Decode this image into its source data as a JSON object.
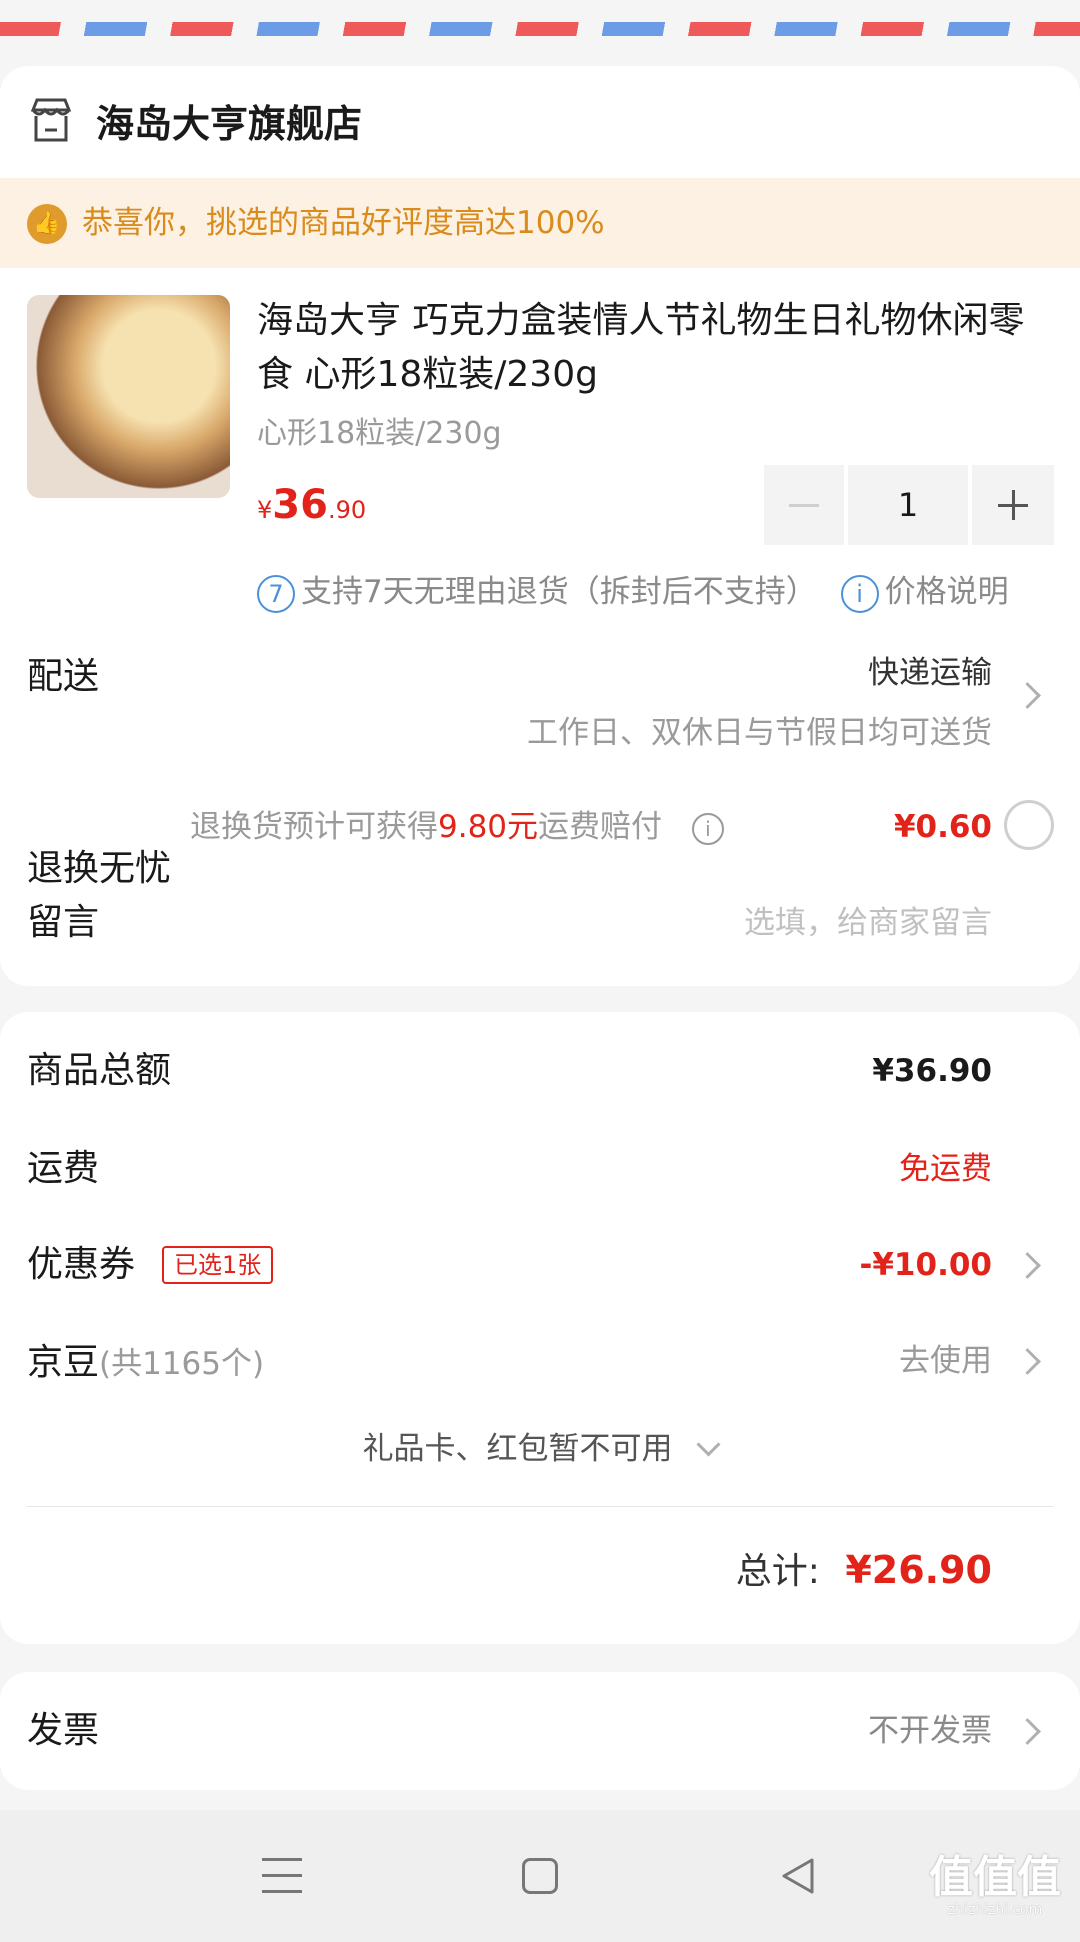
{
  "store": {
    "name": "海岛大亨旗舰店",
    "icon": "store-icon"
  },
  "banner": {
    "text": "恭喜你，挑选的商品好评度高达100%",
    "icon": "thumbs-up-icon",
    "color": "#d98b1c"
  },
  "product": {
    "name": "海岛大亨 巧克力盒装情人节礼物生日礼物休闲零食 心形18粒装/230g",
    "spec": "心形18粒装/230g",
    "price_symbol": "¥",
    "price_int": "36",
    "price_dec": ".90",
    "quantity": "1",
    "after_sale_icon_text": "7",
    "after_sale": "支持7天无理由退货（拆封后不支持）",
    "price_note_icon_text": "i",
    "price_note": "价格说明"
  },
  "delivery": {
    "label": "配送",
    "method": "快递运输",
    "note": "工作日、双休日与节假日均可送货"
  },
  "return_insurance": {
    "label": "退换无忧",
    "desc_prefix": "退换货预计可获得",
    "desc_amount": "9.80元",
    "desc_suffix": "运费赔付",
    "info_icon_text": "i",
    "price": "¥0.60"
  },
  "message": {
    "label": "留言",
    "placeholder": "选填，给商家留言"
  },
  "summary": {
    "subtotal_label": "商品总额",
    "subtotal": "¥36.90",
    "shipping_label": "运费",
    "shipping": "免运费",
    "coupon_label": "优惠券",
    "coupon_badge": "已选1张",
    "coupon_value": "-¥10.00",
    "beans_label": "京豆",
    "beans_count": "(共1165个)",
    "beans_action": "去使用",
    "giftcard": "礼品卡、红包暂不可用",
    "total_label": "总计:",
    "total": "¥26.90"
  },
  "invoice": {
    "label": "发票",
    "value": "不开发票"
  },
  "nav": {
    "menu_icon": "menu-icon",
    "home_icon": "home-square-icon",
    "back_icon": "back-triangle-icon"
  },
  "watermark": {
    "text": "值值值",
    "url": "zhizhizhi.com"
  },
  "colors": {
    "accent_red": "#e2231a",
    "banner_bg": "#fdf1e3",
    "info_blue": "#4b91d9"
  }
}
